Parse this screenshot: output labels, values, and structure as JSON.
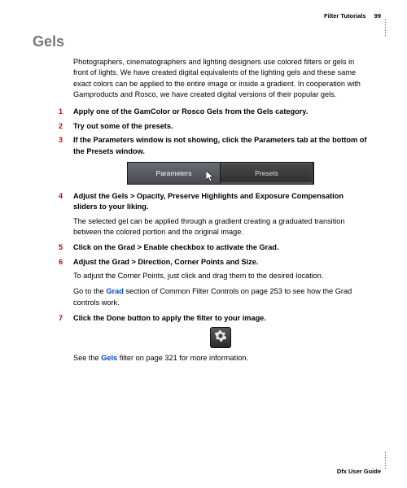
{
  "header": {
    "section": "Filter Tutorials",
    "page_number": "99"
  },
  "title": "Gels",
  "intro": "Photographers, cinematographers and lighting designers use colored filters or gels in front of lights. We have created digital equivalents of the lighting gels and these same exact colors can be applied to the entire image or inside a gradient. In cooperation with Gamproducts and Rosco, we have created digital versions of their popular gels.",
  "steps": {
    "s1": {
      "num": "1",
      "text": "Apply one of the GamColor or Rosco Gels from the Gels category."
    },
    "s2": {
      "num": "2",
      "text": "Try out some of the presets."
    },
    "s3": {
      "num": "3",
      "text": "If the Parameters window is not showing, click the Parameters tab at the bottom of the Presets window."
    },
    "s4": {
      "num": "4",
      "text": "Adjust the Gels > Opacity, Preserve Highlights and Exposure Compensation sliders to your liking."
    },
    "s5": {
      "num": "5",
      "text": "Click on the Grad > Enable checkbox to activate the Grad."
    },
    "s6": {
      "num": "6",
      "text": "Adjust the Grad > Direction, Corner Points and Size."
    },
    "s7": {
      "num": "7",
      "text": "Click the Done button to apply the filter to your image."
    }
  },
  "tabs": {
    "parameters": "Parameters",
    "presets": "Presets"
  },
  "para_after4": "The selected gel can be applied through a gradient creating a graduated transition between the colored portion and the original image.",
  "para_after6": "To adjust the Corner Points, just click and drag them to the desired location.",
  "grad_sentence": {
    "pre": "Go to the ",
    "link": "Grad",
    "post": " section of Common Filter Controls on page 253 to see how the Grad controls work."
  },
  "gels_sentence": {
    "pre": "See the ",
    "link": "Gels",
    "post": " filter on page 321 for more information."
  },
  "footer": "Dfx User Guide"
}
